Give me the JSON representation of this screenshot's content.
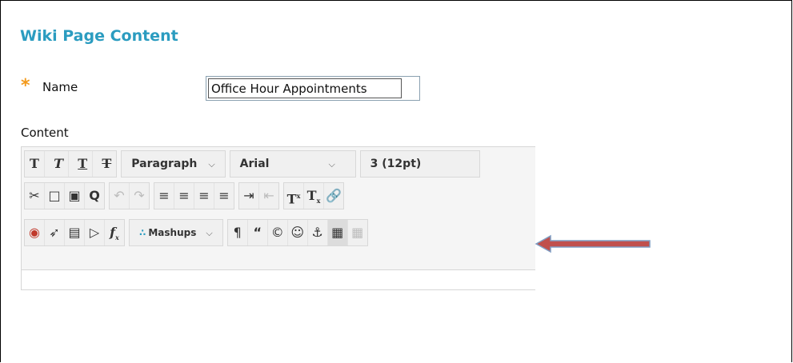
{
  "form": {
    "section_title": "Wiki Page Content",
    "required_marker": "*",
    "name_label": "Name",
    "name_value": "Office Hour Appointments",
    "content_label": "Content"
  },
  "toolbar": {
    "row1": {
      "format_buttons": [
        "bold",
        "italic",
        "underline",
        "strikethrough"
      ],
      "format_glyphs": [
        "T",
        "T",
        "T",
        "T"
      ],
      "paragraph": "Paragraph",
      "font": "Arial",
      "size": "3 (12pt)"
    },
    "row2": {
      "icons": [
        "cut-icon",
        "copy-icon",
        "paste-icon",
        "find-icon",
        "undo-icon",
        "redo-icon",
        "align-left-icon",
        "align-center-icon",
        "align-right-icon",
        "justify-icon",
        "indent-icon",
        "outdent-icon",
        "superscript-icon",
        "subscript-icon",
        "link-icon"
      ]
    },
    "row3": {
      "icons": [
        "record-icon",
        "attach-icon",
        "image-icon",
        "media-icon",
        "formula-icon",
        "mashups-icon",
        "pilcrow-icon",
        "quote-icon",
        "copyright-icon",
        "emoticon-icon",
        "anchor-icon",
        "table-icon",
        "table-grid-icon"
      ],
      "mashups": "Mashups",
      "formula_glyph": "f",
      "formula_sub": "x"
    }
  },
  "colors": {
    "title": "#2b9cc0",
    "required": "#f39a1c",
    "arrow": "#c0504d"
  }
}
